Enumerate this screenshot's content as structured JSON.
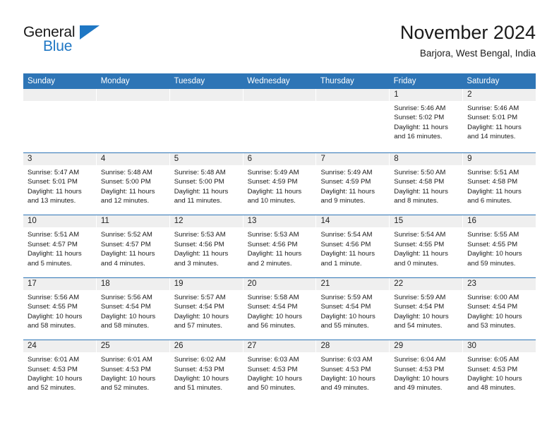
{
  "brand": {
    "name_part1": "General",
    "name_part2": "Blue",
    "logo_icon": "blue-triangle-icon"
  },
  "header": {
    "title": "November 2024",
    "location": "Barjora, West Bengal, India"
  },
  "calendar": {
    "weekdays": [
      "Sunday",
      "Monday",
      "Tuesday",
      "Wednesday",
      "Thursday",
      "Friday",
      "Saturday"
    ],
    "colors": {
      "header_blue": "#2e75b6",
      "daynum_band": "#efefef",
      "brand_blue": "#1f77c4",
      "text": "#1a1a1a"
    },
    "weeks": [
      [
        {
          "day": "",
          "empty": true
        },
        {
          "day": "",
          "empty": true
        },
        {
          "day": "",
          "empty": true
        },
        {
          "day": "",
          "empty": true
        },
        {
          "day": "",
          "empty": true
        },
        {
          "day": "1",
          "sunrise": "Sunrise: 5:46 AM",
          "sunset": "Sunset: 5:02 PM",
          "daylight1": "Daylight: 11 hours",
          "daylight2": "and 16 minutes."
        },
        {
          "day": "2",
          "sunrise": "Sunrise: 5:46 AM",
          "sunset": "Sunset: 5:01 PM",
          "daylight1": "Daylight: 11 hours",
          "daylight2": "and 14 minutes."
        }
      ],
      [
        {
          "day": "3",
          "sunrise": "Sunrise: 5:47 AM",
          "sunset": "Sunset: 5:01 PM",
          "daylight1": "Daylight: 11 hours",
          "daylight2": "and 13 minutes."
        },
        {
          "day": "4",
          "sunrise": "Sunrise: 5:48 AM",
          "sunset": "Sunset: 5:00 PM",
          "daylight1": "Daylight: 11 hours",
          "daylight2": "and 12 minutes."
        },
        {
          "day": "5",
          "sunrise": "Sunrise: 5:48 AM",
          "sunset": "Sunset: 5:00 PM",
          "daylight1": "Daylight: 11 hours",
          "daylight2": "and 11 minutes."
        },
        {
          "day": "6",
          "sunrise": "Sunrise: 5:49 AM",
          "sunset": "Sunset: 4:59 PM",
          "daylight1": "Daylight: 11 hours",
          "daylight2": "and 10 minutes."
        },
        {
          "day": "7",
          "sunrise": "Sunrise: 5:49 AM",
          "sunset": "Sunset: 4:59 PM",
          "daylight1": "Daylight: 11 hours",
          "daylight2": "and 9 minutes."
        },
        {
          "day": "8",
          "sunrise": "Sunrise: 5:50 AM",
          "sunset": "Sunset: 4:58 PM",
          "daylight1": "Daylight: 11 hours",
          "daylight2": "and 8 minutes."
        },
        {
          "day": "9",
          "sunrise": "Sunrise: 5:51 AM",
          "sunset": "Sunset: 4:58 PM",
          "daylight1": "Daylight: 11 hours",
          "daylight2": "and 6 minutes."
        }
      ],
      [
        {
          "day": "10",
          "sunrise": "Sunrise: 5:51 AM",
          "sunset": "Sunset: 4:57 PM",
          "daylight1": "Daylight: 11 hours",
          "daylight2": "and 5 minutes."
        },
        {
          "day": "11",
          "sunrise": "Sunrise: 5:52 AM",
          "sunset": "Sunset: 4:57 PM",
          "daylight1": "Daylight: 11 hours",
          "daylight2": "and 4 minutes."
        },
        {
          "day": "12",
          "sunrise": "Sunrise: 5:53 AM",
          "sunset": "Sunset: 4:56 PM",
          "daylight1": "Daylight: 11 hours",
          "daylight2": "and 3 minutes."
        },
        {
          "day": "13",
          "sunrise": "Sunrise: 5:53 AM",
          "sunset": "Sunset: 4:56 PM",
          "daylight1": "Daylight: 11 hours",
          "daylight2": "and 2 minutes."
        },
        {
          "day": "14",
          "sunrise": "Sunrise: 5:54 AM",
          "sunset": "Sunset: 4:56 PM",
          "daylight1": "Daylight: 11 hours",
          "daylight2": "and 1 minute."
        },
        {
          "day": "15",
          "sunrise": "Sunrise: 5:54 AM",
          "sunset": "Sunset: 4:55 PM",
          "daylight1": "Daylight: 11 hours",
          "daylight2": "and 0 minutes."
        },
        {
          "day": "16",
          "sunrise": "Sunrise: 5:55 AM",
          "sunset": "Sunset: 4:55 PM",
          "daylight1": "Daylight: 10 hours",
          "daylight2": "and 59 minutes."
        }
      ],
      [
        {
          "day": "17",
          "sunrise": "Sunrise: 5:56 AM",
          "sunset": "Sunset: 4:55 PM",
          "daylight1": "Daylight: 10 hours",
          "daylight2": "and 58 minutes."
        },
        {
          "day": "18",
          "sunrise": "Sunrise: 5:56 AM",
          "sunset": "Sunset: 4:54 PM",
          "daylight1": "Daylight: 10 hours",
          "daylight2": "and 58 minutes."
        },
        {
          "day": "19",
          "sunrise": "Sunrise: 5:57 AM",
          "sunset": "Sunset: 4:54 PM",
          "daylight1": "Daylight: 10 hours",
          "daylight2": "and 57 minutes."
        },
        {
          "day": "20",
          "sunrise": "Sunrise: 5:58 AM",
          "sunset": "Sunset: 4:54 PM",
          "daylight1": "Daylight: 10 hours",
          "daylight2": "and 56 minutes."
        },
        {
          "day": "21",
          "sunrise": "Sunrise: 5:59 AM",
          "sunset": "Sunset: 4:54 PM",
          "daylight1": "Daylight: 10 hours",
          "daylight2": "and 55 minutes."
        },
        {
          "day": "22",
          "sunrise": "Sunrise: 5:59 AM",
          "sunset": "Sunset: 4:54 PM",
          "daylight1": "Daylight: 10 hours",
          "daylight2": "and 54 minutes."
        },
        {
          "day": "23",
          "sunrise": "Sunrise: 6:00 AM",
          "sunset": "Sunset: 4:54 PM",
          "daylight1": "Daylight: 10 hours",
          "daylight2": "and 53 minutes."
        }
      ],
      [
        {
          "day": "24",
          "sunrise": "Sunrise: 6:01 AM",
          "sunset": "Sunset: 4:53 PM",
          "daylight1": "Daylight: 10 hours",
          "daylight2": "and 52 minutes."
        },
        {
          "day": "25",
          "sunrise": "Sunrise: 6:01 AM",
          "sunset": "Sunset: 4:53 PM",
          "daylight1": "Daylight: 10 hours",
          "daylight2": "and 52 minutes."
        },
        {
          "day": "26",
          "sunrise": "Sunrise: 6:02 AM",
          "sunset": "Sunset: 4:53 PM",
          "daylight1": "Daylight: 10 hours",
          "daylight2": "and 51 minutes."
        },
        {
          "day": "27",
          "sunrise": "Sunrise: 6:03 AM",
          "sunset": "Sunset: 4:53 PM",
          "daylight1": "Daylight: 10 hours",
          "daylight2": "and 50 minutes."
        },
        {
          "day": "28",
          "sunrise": "Sunrise: 6:03 AM",
          "sunset": "Sunset: 4:53 PM",
          "daylight1": "Daylight: 10 hours",
          "daylight2": "and 49 minutes."
        },
        {
          "day": "29",
          "sunrise": "Sunrise: 6:04 AM",
          "sunset": "Sunset: 4:53 PM",
          "daylight1": "Daylight: 10 hours",
          "daylight2": "and 49 minutes."
        },
        {
          "day": "30",
          "sunrise": "Sunrise: 6:05 AM",
          "sunset": "Sunset: 4:53 PM",
          "daylight1": "Daylight: 10 hours",
          "daylight2": "and 48 minutes."
        }
      ]
    ]
  }
}
